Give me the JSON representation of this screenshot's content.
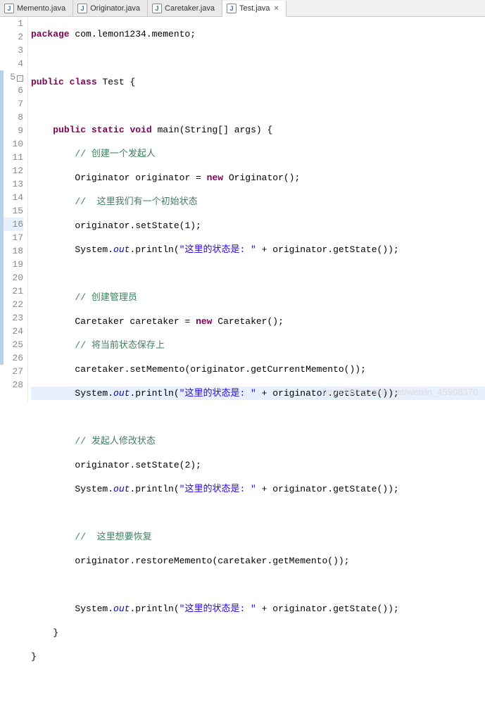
{
  "tabs": [
    {
      "label": "Memento.java",
      "active": false
    },
    {
      "label": "Originator.java",
      "active": false
    },
    {
      "label": "Caretaker.java",
      "active": false
    },
    {
      "label": "Test.java",
      "active": true
    }
  ],
  "lines": {
    "total": 28,
    "fold_at": 5,
    "highlighted": 16,
    "blue_strip_start": 5,
    "blue_strip_end": 26
  },
  "code": {
    "l1": {
      "kw1": "package",
      "txt1": " com.lemon1234.memento;"
    },
    "l3": {
      "kw1": "public",
      "kw2": "class",
      "txt1": " Test {"
    },
    "l5": {
      "kw1": "public",
      "kw2": "static",
      "kw3": "void",
      "txt1": " main(String[] args) {"
    },
    "l6": {
      "cm": "// 创建一个发起人"
    },
    "l7": {
      "txt1": "Originator originator = ",
      "kw1": "new",
      "txt2": " Originator();"
    },
    "l8": {
      "cm": "//  这里我们有一个初始状态"
    },
    "l9": {
      "txt1": "originator.setState(1);"
    },
    "l10": {
      "txt1": "System.",
      "fld": "out",
      "txt2": ".println(",
      "str": "\"这里的状态是: \"",
      "txt3": " + originator.getState());"
    },
    "l12": {
      "cm": "// 创建管理员"
    },
    "l13": {
      "txt1": "Caretaker caretaker = ",
      "kw1": "new",
      "txt2": " Caretaker();"
    },
    "l14": {
      "cm": "// 将当前状态保存上"
    },
    "l15": {
      "txt1": "caretaker.setMemento(originator.getCurrentMemento());"
    },
    "l16": {
      "txt1": "System.",
      "fld": "out",
      "txt2": ".println(",
      "str": "\"这里的状态是: \"",
      "txt3": " + originator.getState());"
    },
    "l18": {
      "cm": "// 发起人修改状态"
    },
    "l19": {
      "txt1": "originator.setState(2);"
    },
    "l20": {
      "txt1": "System.",
      "fld": "out",
      "txt2": ".println(",
      "str": "\"这里的状态是: \"",
      "txt3": " + originator.getState());"
    },
    "l22": {
      "cm": "//  这里想要恢复"
    },
    "l23": {
      "txt1": "originator.restoreMemento(caretaker.getMemento());"
    },
    "l25": {
      "txt1": "System.",
      "fld": "out",
      "txt2": ".println(",
      "str": "\"这里的状态是: \"",
      "txt3": " + originator.getState());"
    },
    "l26": {
      "txt1": "}"
    },
    "l27": {
      "txt1": "}"
    }
  },
  "watermark": "https://blog.csdn.net/weixin_45908370"
}
